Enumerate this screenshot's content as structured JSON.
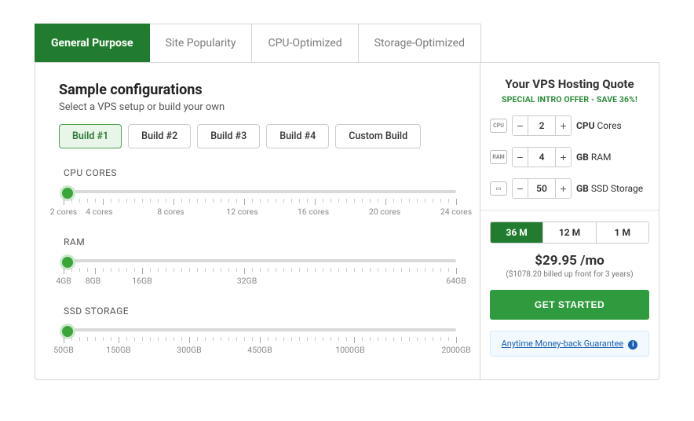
{
  "tabs": [
    "General Purpose",
    "Site Popularity",
    "CPU-Optimized",
    "Storage-Optimized"
  ],
  "left": {
    "title": "Sample configurations",
    "subtitle": "Select a VPS setup or build your own",
    "builds": [
      "Build #1",
      "Build #2",
      "Build #3",
      "Build #4",
      "Custom Build"
    ],
    "sliders": {
      "cpu": {
        "label": "CPU CORES",
        "marks": [
          "2 cores",
          "4 cores",
          "8 cores",
          "12 cores",
          "16 cores",
          "20 cores",
          "24 cores"
        ]
      },
      "ram": {
        "label": "RAM",
        "marks": [
          "4GB",
          "8GB",
          "16GB",
          "32GB",
          "64GB"
        ]
      },
      "ssd": {
        "label": "SSD STORAGE",
        "marks": [
          "50GB",
          "150GB",
          "300GB",
          "450GB",
          "1000GB",
          "2000GB"
        ]
      }
    }
  },
  "quote": {
    "title": "Your VPS Hosting Quote",
    "offer": "SPECIAL INTRO OFFER - SAVE 36%!",
    "icons": {
      "cpu": "CPU",
      "ram": "RAM",
      "ssd": "▭"
    },
    "cpu": {
      "value": "2",
      "label_bold": "CPU",
      "label_rest": " Cores"
    },
    "ram": {
      "value": "4",
      "label_bold": "GB",
      "label_rest": " RAM"
    },
    "ssd": {
      "value": "50",
      "label_bold": "GB",
      "label_rest": " SSD Storage"
    },
    "terms": [
      "36 M",
      "12 M",
      "1 M"
    ],
    "price": "$29.95 /mo",
    "price_note": "($1078.20 billed up front for 3 years)",
    "cta": "GET STARTED",
    "guarantee": "Anytime Money-back Guarantee"
  }
}
